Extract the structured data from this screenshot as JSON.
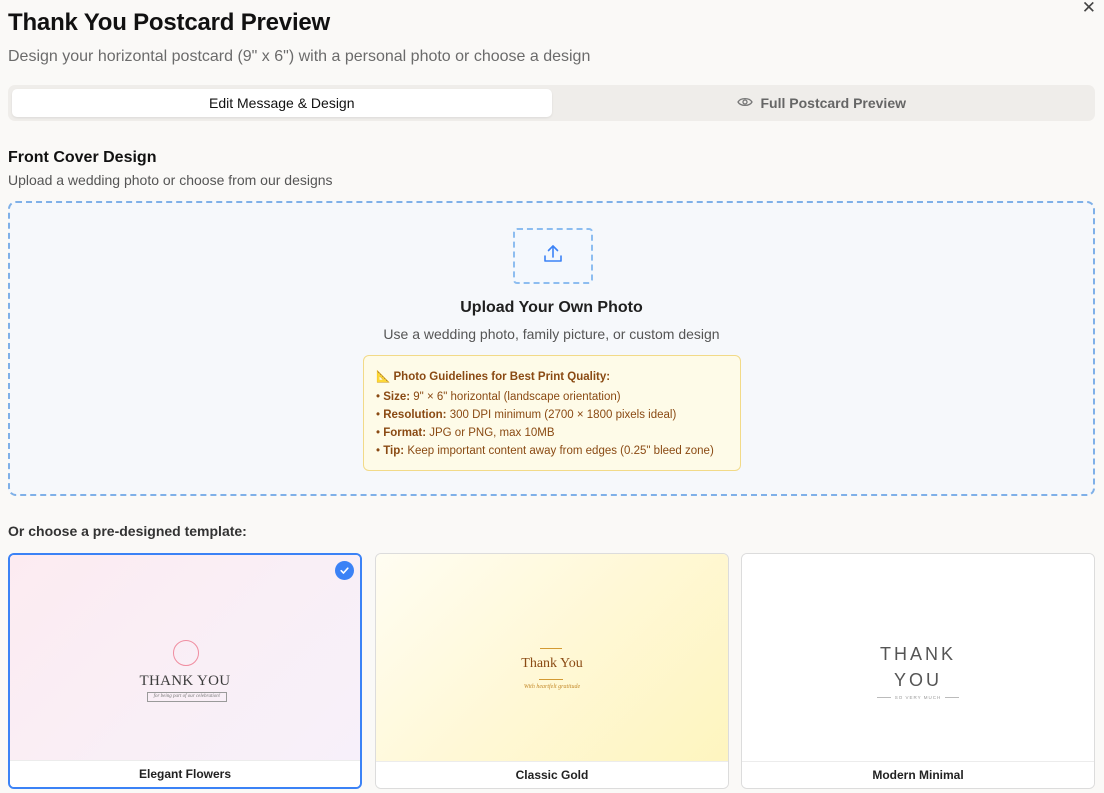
{
  "dialog": {
    "title": "Thank You Postcard Preview",
    "subtitle": "Design your horizontal postcard (9\" x 6\") with a personal photo or choose a design",
    "close_icon": "close-icon"
  },
  "tabs": [
    {
      "label": "Edit Message & Design",
      "active": true
    },
    {
      "label": "Full Postcard Preview",
      "active": false,
      "icon": "eye-icon"
    }
  ],
  "front_cover": {
    "title": "Front Cover Design",
    "subtitle": "Upload a wedding photo or choose from our designs"
  },
  "upload": {
    "icon": "upload-icon",
    "title": "Upload Your Own Photo",
    "description": "Use a wedding photo, family picture, or custom design",
    "guidelines": {
      "heading": "📐 Photo Guidelines for Best Print Quality:",
      "items": [
        {
          "key": "Size:",
          "value": "9\" × 6\" horizontal (landscape orientation)"
        },
        {
          "key": "Resolution:",
          "value": "300 DPI minimum (2700 × 1800 pixels ideal)"
        },
        {
          "key": "Format:",
          "value": "JPG or PNG, max 10MB"
        },
        {
          "key": "Tip:",
          "value": "Keep important content away from edges (0.25\" bleed zone)"
        }
      ]
    }
  },
  "templates": {
    "label": "Or choose a pre-designed template:",
    "items": [
      {
        "name": "Elegant Flowers",
        "selected": true,
        "art_title": "THANK YOU",
        "art_sub": "for being part of our celebration!"
      },
      {
        "name": "Classic Gold",
        "selected": false,
        "art_title": "Thank You",
        "art_sub": "With heartfelt gratitude"
      },
      {
        "name": "Modern Minimal",
        "selected": false,
        "art_title_line1": "THANK",
        "art_title_line2": "YOU",
        "art_sub": "SO VERY MUCH"
      }
    ]
  },
  "colors": {
    "accent": "#3b82f6",
    "upload_border": "#7fb0e8",
    "guideline_text": "#8a4a13",
    "guideline_bg": "#fefbe8"
  }
}
